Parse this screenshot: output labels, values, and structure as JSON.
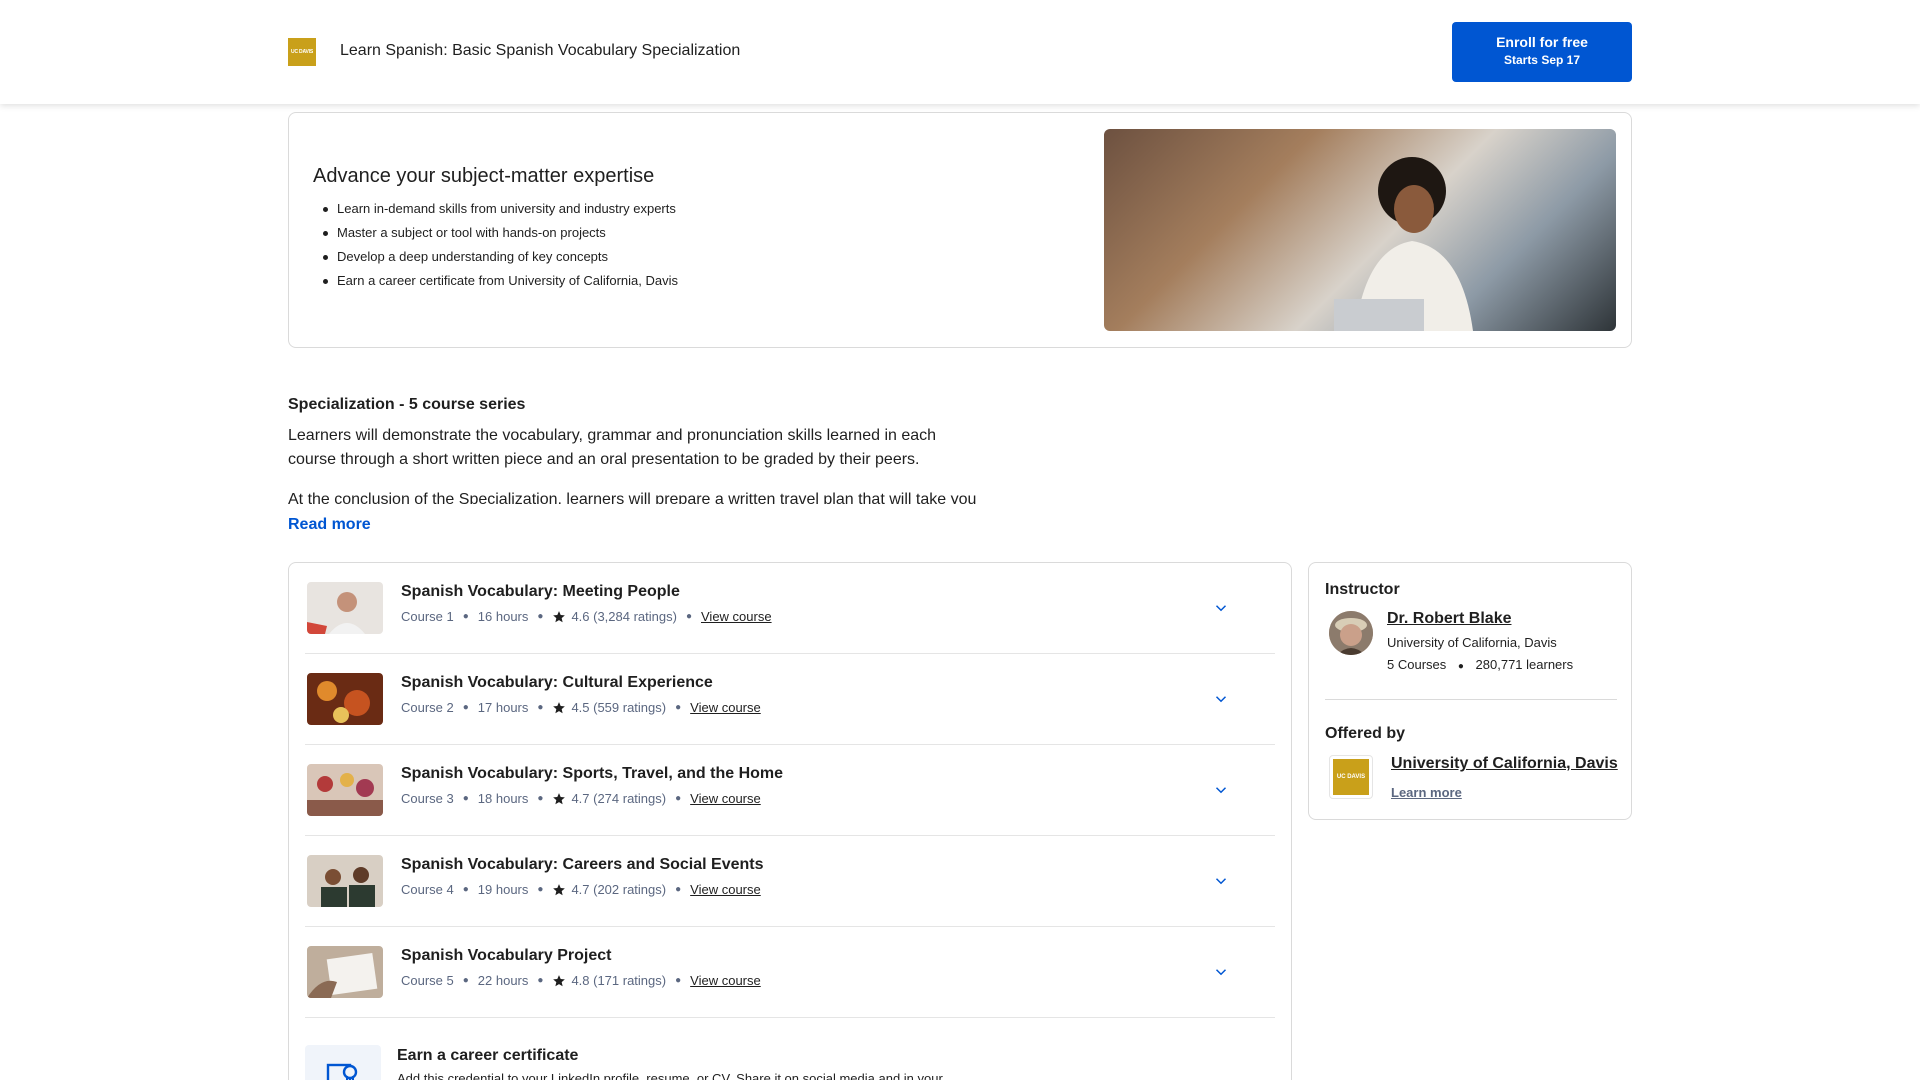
{
  "header": {
    "logo_text": "UC DAVIS",
    "title": "Learn Spanish: Basic Spanish Vocabulary Specialization",
    "enroll_label": "Enroll for free",
    "enroll_sub": "Starts Sep 17"
  },
  "promo": {
    "heading": "Advance your subject-matter expertise",
    "bullets": [
      "Learn in-demand skills from university and industry experts",
      "Master a subject or tool with hands-on projects",
      "Develop a deep understanding of key concepts",
      "Earn a career certificate from University of California, Davis"
    ]
  },
  "specialization": {
    "title": "Specialization - 5 course series",
    "desc": "Learners will demonstrate the vocabulary, grammar and pronunciation skills learned in each course through a short written piece and an oral presentation to be graded by their peers.",
    "desc_cut": "At the conclusion of the Specialization, learners will prepare a written travel plan that will take you",
    "read_more": "Read more"
  },
  "courses": [
    {
      "title": "Spanish Vocabulary: Meeting People",
      "num": "Course 1",
      "hours": "16 hours",
      "rating": "4.6 (3,284 ratings)",
      "link": "View course"
    },
    {
      "title": "Spanish Vocabulary: Cultural Experience",
      "num": "Course 2",
      "hours": "17 hours",
      "rating": "4.5 (559 ratings)",
      "link": "View course"
    },
    {
      "title": "Spanish Vocabulary: Sports, Travel, and the Home",
      "num": "Course 3",
      "hours": "18 hours",
      "rating": "4.7 (274 ratings)",
      "link": "View course"
    },
    {
      "title": "Spanish Vocabulary: Careers and Social Events",
      "num": "Course 4",
      "hours": "19 hours",
      "rating": "4.7 (202 ratings)",
      "link": "View course"
    },
    {
      "title": "Spanish Vocabulary Project",
      "num": "Course 5",
      "hours": "22 hours",
      "rating": "4.8 (171 ratings)",
      "link": "View course"
    }
  ],
  "certificate": {
    "title": "Earn a career certificate",
    "desc": "Add this credential to your LinkedIn profile, resume, or CV. Share it on social media and in your"
  },
  "instructor": {
    "heading": "Instructor",
    "name": "Dr. Robert Blake",
    "org": "University of California, Davis",
    "courses": "5 Courses",
    "learners": "280,771 learners"
  },
  "offered_by": {
    "heading": "Offered by",
    "logo_text": "UC DAVIS",
    "name": "University of California, Davis",
    "learn_more": "Learn more"
  },
  "colors": {
    "accent": "#0056d2",
    "brand_gold": "#c9a01a",
    "meta_text": "#5b6780"
  },
  "icons": {
    "star": "star-icon",
    "chevron": "chevron-down-icon",
    "certificate": "certificate-icon"
  }
}
